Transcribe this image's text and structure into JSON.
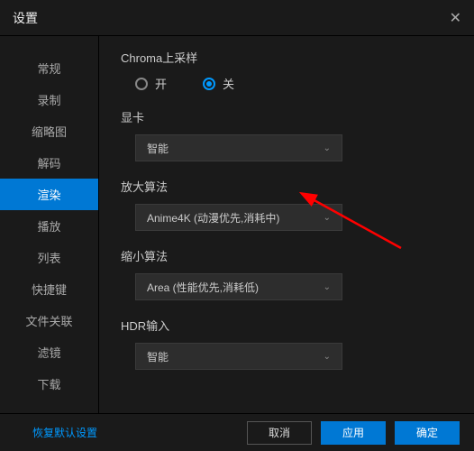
{
  "titlebar": {
    "title": "设置"
  },
  "sidebar": {
    "items": [
      {
        "label": "常规"
      },
      {
        "label": "录制"
      },
      {
        "label": "缩略图"
      },
      {
        "label": "解码"
      },
      {
        "label": "渲染"
      },
      {
        "label": "播放"
      },
      {
        "label": "列表"
      },
      {
        "label": "快捷键"
      },
      {
        "label": "文件关联"
      },
      {
        "label": "滤镜"
      },
      {
        "label": "下载"
      }
    ]
  },
  "main": {
    "chroma": {
      "label": "Chroma上采样",
      "option_on": "开",
      "option_off": "关"
    },
    "gpu": {
      "label": "显卡",
      "value": "智能"
    },
    "upscale": {
      "label": "放大算法",
      "value": "Anime4K (动漫优先,消耗中)"
    },
    "downscale": {
      "label": "缩小算法",
      "value": "Area (性能优先,消耗低)"
    },
    "hdr": {
      "label": "HDR输入",
      "value": "智能"
    }
  },
  "footer": {
    "reset": "恢复默认设置",
    "cancel": "取消",
    "apply": "应用",
    "ok": "确定"
  }
}
